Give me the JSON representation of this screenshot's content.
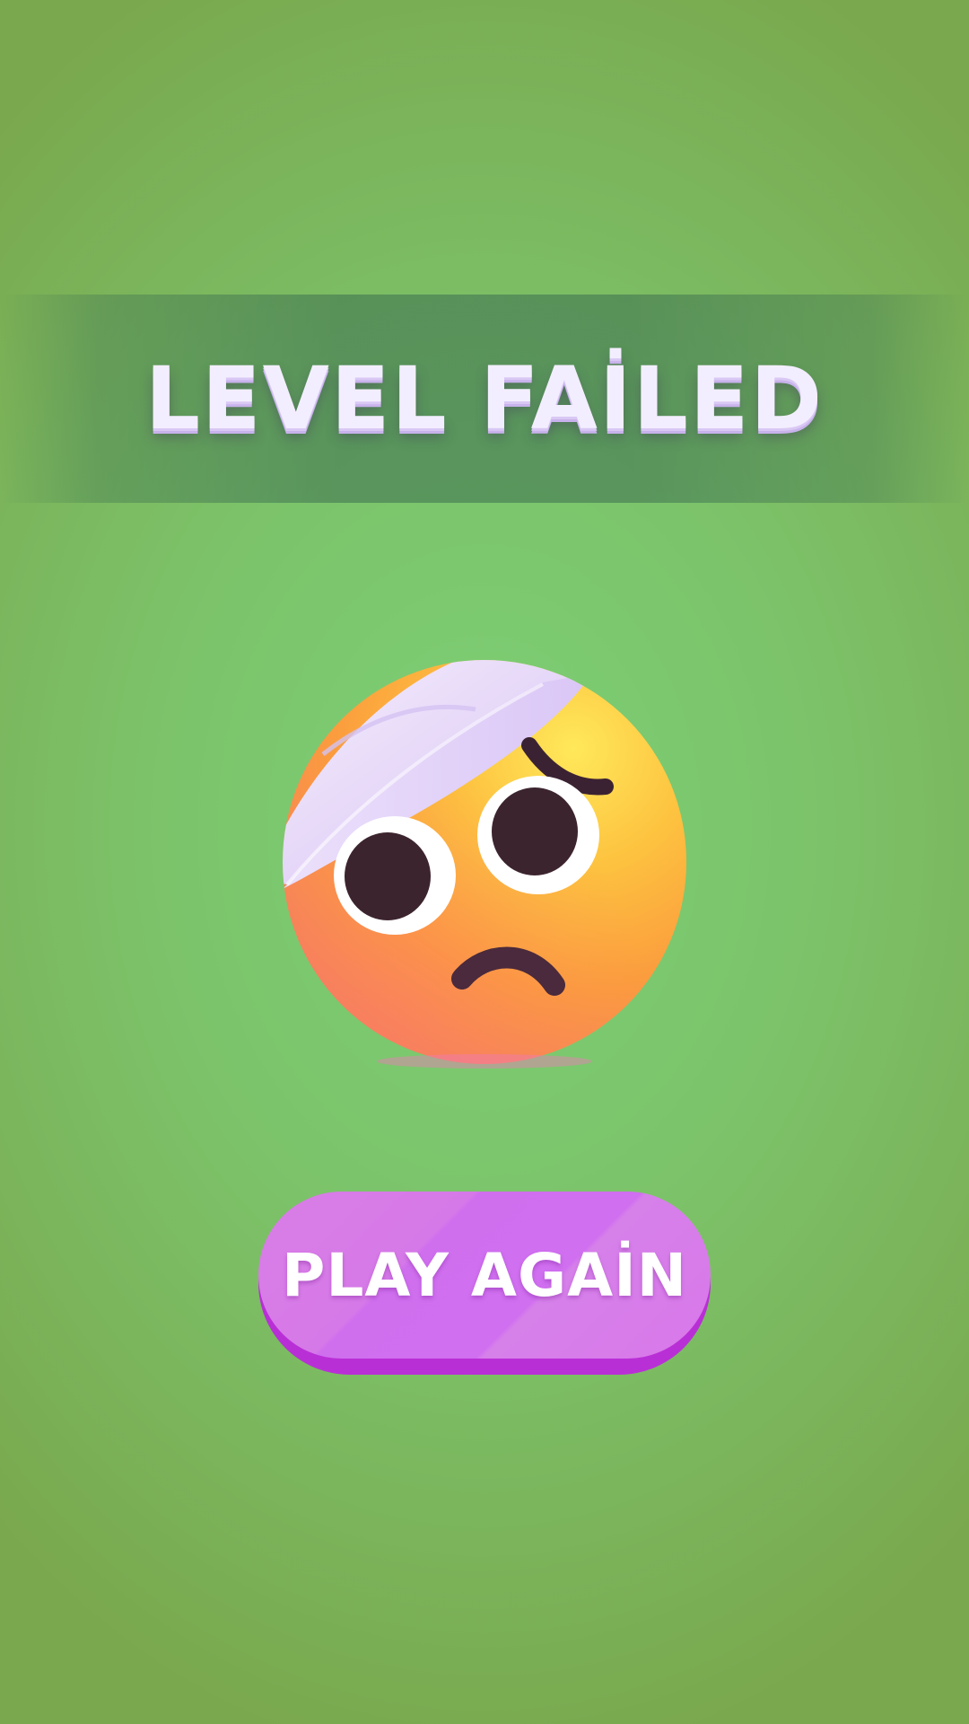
{
  "screen": {
    "title": "LEVEL FAİLED",
    "button_label": "PLAY AGAİN",
    "emoji_icon": "face-with-head-bandage-icon"
  },
  "colors": {
    "background": "#7cc36a",
    "banner": "#5f9f6c",
    "title_text": "#f3eeff",
    "button_face": "#d478ea",
    "button_shadow": "#b92fd6",
    "emoji_face": "#fbb13c",
    "bandage": "#efe4fb"
  }
}
